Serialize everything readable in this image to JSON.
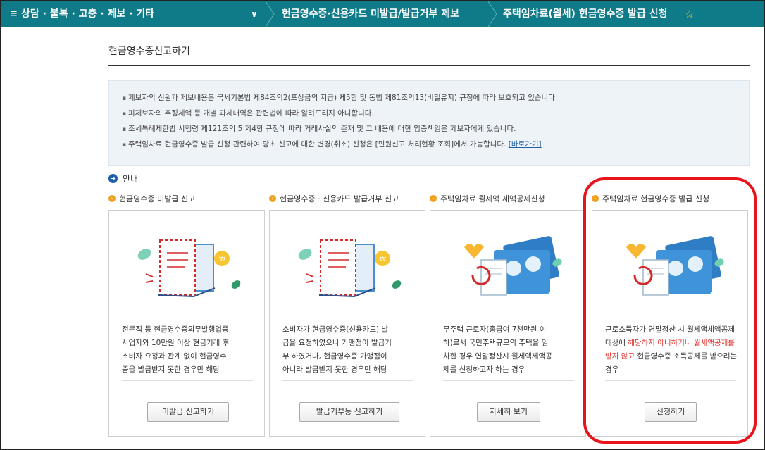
{
  "topbar": {
    "menu_icon": "≡",
    "crumb1": "상담 · 불복 · 고충 · 제보 · 기타",
    "chevron": "∨",
    "crumb2": "현금영수증·신용카드 미발급/발급거부 제보",
    "crumb3": "주택임차료(월세) 현금영수증 발급 신청",
    "star": "☆",
    "bg_color": "#0f7a88"
  },
  "main": {
    "title": "현금영수증신고하기",
    "notices": [
      "제보자의 신원과 제보내용은 국세기본법 제84조의2(포상금의 지급) 제5항 및 동법 제81조의13(비밀유지) 규정에 따라 보호되고 있습니다.",
      "피제보자의 추징세액 등 개별 과세내역은 관련법에 따라 알려드리지 아니합니다.",
      "조세특례제한법 시행령 제121조의 5 제4항 규정에 따라 거래사실의 존재 및 그 내용에 대한 입증책임은 제보자에게 있습니다.",
      "주택임차료 현금영수증 발급 신청 관련하여 당초 신고에 대한 변경(취소) 신청은 [민원신고 처리현황 조회]에서 가능합니다."
    ],
    "notice_link": "[바로가기]",
    "guide_label": "안내"
  },
  "cards": [
    {
      "category": "현금영수증 미발급 신고",
      "desc": [
        "전문직 등 현금영수증의무발행업종",
        "사업자와 10만원 이상 현금거래 후",
        "소비자 요청과 관계 없이 현금영수",
        "증을 발급받지 못한 경우만 해당"
      ],
      "button": "미발급 신고하기"
    },
    {
      "category": "현금영수증 · 신용카드 발급거부 신고",
      "desc": [
        "소비자가 현금영수증(신용카드) 발",
        "급을 요청하였으나 가맹점이 발급거",
        "부 하였거나, 현금영수증 가맹점이",
        "아니라 발급받지 못한 경우만 해당"
      ],
      "button": "발급거부등 신고하기"
    },
    {
      "category": "주택임차료 월세액 세액공제신청",
      "desc": [
        "무주택 근로자(총급여 7천만원 이",
        "하)로서 국민주택규모의 주택을 임",
        "차한 경우 연말정산시 월세액세액공",
        "제를 신청하고자 하는 경우"
      ],
      "button": "자세히 보기"
    },
    {
      "category": "주택임차료 현금영수증 발급 신청",
      "desc_pre": "근로소득자가 연말정산 시 월세액세액공제 대상에 ",
      "desc_red": "해당하지 아니하거나 월세액공제를 받지 않고",
      "desc_post": " 현금영수증 소득공제를 받으려는 경우",
      "button": "신청하기"
    }
  ],
  "colors": {
    "accent_orange": "#f0a020",
    "link_blue": "#1f5fa8",
    "highlight_red": "#e8141b"
  }
}
